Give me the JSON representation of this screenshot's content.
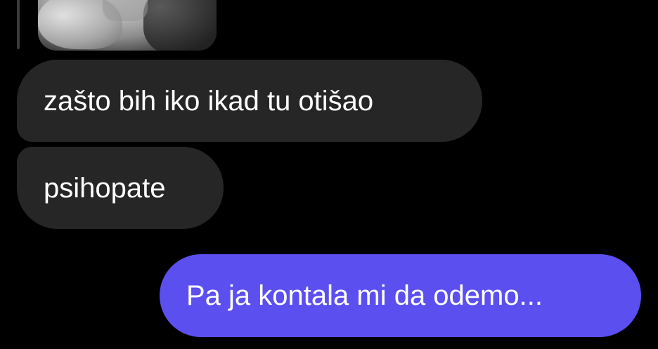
{
  "conversation": {
    "messages": [
      {
        "direction": "incoming",
        "text": "zašto bih iko ikad tu otišao"
      },
      {
        "direction": "incoming",
        "text": "psihopate"
      },
      {
        "direction": "outgoing",
        "text": "Pa ja kontala mi da odemo..."
      }
    ]
  },
  "colors": {
    "background": "#000000",
    "incoming_bubble": "#262626",
    "outgoing_bubble": "#5b4ff0",
    "text": "#ffffff"
  },
  "icons": {
    "reply_media": "video-thumbnail-icon"
  }
}
